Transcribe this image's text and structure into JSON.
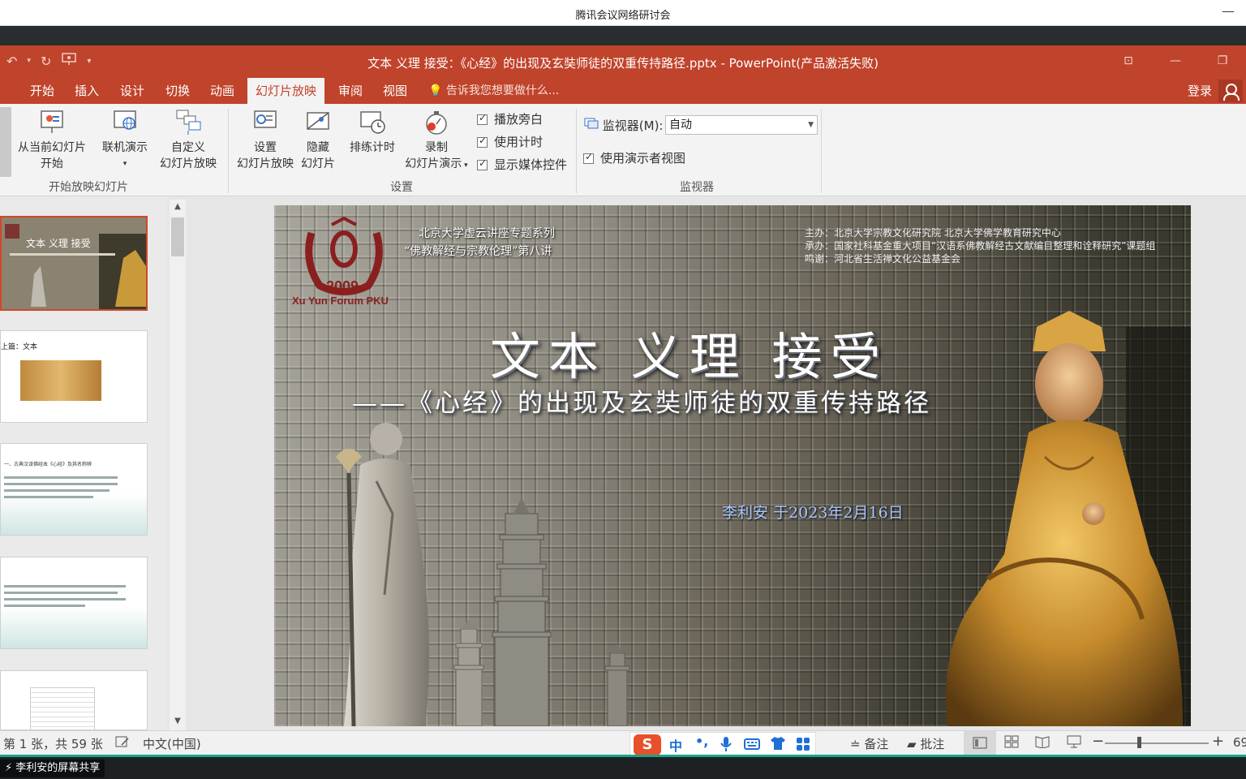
{
  "meeting": {
    "title": "腾讯会议网络研讨会"
  },
  "ppt": {
    "doc_title": "文本 义理 接受：《心经》的出现及玄奘师徒的双重传持路径.pptx - PowerPoint(产品激活失败)",
    "tabs": [
      "开始",
      "插入",
      "设计",
      "切换",
      "动画",
      "幻灯片放映",
      "审阅",
      "视图"
    ],
    "active_tab": "幻灯片放映",
    "tell_me": "告诉我您想要做什么...",
    "login": "登录"
  },
  "ribbon": {
    "start_group": {
      "from_current_line1": "从当前幻灯片",
      "from_current_line2": "开始",
      "online": "联机演示",
      "custom_line1": "自定义",
      "custom_line2": "幻灯片放映",
      "label": "开始放映幻灯片"
    },
    "setup_group": {
      "setup_line1": "设置",
      "setup_line2": "幻灯片放映",
      "hide_line1": "隐藏",
      "hide_line2": "幻灯片",
      "rehearse": "排练计时",
      "record_line1": "录制",
      "record_line2": "幻灯片演示",
      "play_narration": "播放旁白",
      "use_timings": "使用计时",
      "show_media": "显示媒体控件",
      "label": "设置"
    },
    "monitor_group": {
      "monitor_label": "监视器(M):",
      "monitor_value": "自动",
      "presenter_view": "使用演示者视图",
      "label": "监视器"
    }
  },
  "thumbnails": {
    "thumb2_caption": "上篇：文本",
    "thumb3_heading": "一、古典汉译佛经本《心经》及其名称辨"
  },
  "slide": {
    "logo_year": "2009",
    "logo_forum": "Xu Yun Forum PKU",
    "series_line1": "北京大学虚云讲座专题系列",
    "series_line2": "“佛教解经与宗教伦理”第八讲",
    "sponsor_host": "主办：北京大学宗教文化研究院 北京大学佛学教育研究中心",
    "sponsor_organizer": "承办：国家社科基金重大项目“汉语系佛教解经古文献编目整理和诠释研究”课题组",
    "sponsor_thanks": "鸣谢：河北省生活禅文化公益基金会",
    "main_title": "文本 义理 接受",
    "sub_title": "——《心经》的出现及玄奘师徒的双重传持路径",
    "author_date": "李利安   于2023年2月16日"
  },
  "status": {
    "slide_counter": "第 1 张，共 59 张",
    "language": "中文(中国)",
    "notes": "备注",
    "comments": "批注",
    "zoom": "69",
    "ime_lang": "中",
    "ime_punct": "•,"
  },
  "share": {
    "label": "李利安的屏幕共享"
  },
  "colors": {
    "ppt_red": "#c0432b",
    "selection": "#d24726",
    "share_accent": "#17a589"
  }
}
